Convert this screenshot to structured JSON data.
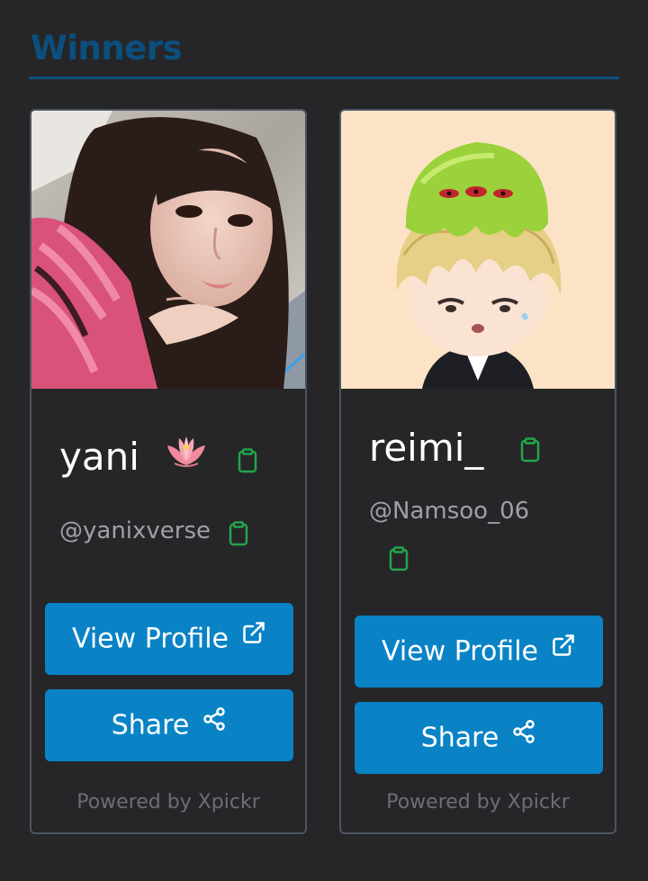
{
  "page": {
    "heading": "Winners",
    "accent_color": "#0b4f7e",
    "button_color": "#0983c6",
    "copy_icon_color": "#22a54a"
  },
  "cards": [
    {
      "display_name": "yani",
      "name_emoji": "lotus-emoji",
      "handle": "@yanixverse",
      "photo": "portrait-photo",
      "view_label": "View Profile",
      "share_label": "Share",
      "powered_by": "Powered by Xpickr"
    },
    {
      "display_name": "reimi_",
      "handle": "@Namsoo_06",
      "photo": "chibi-cartoon-avatar",
      "view_label": "View Profile",
      "share_label": "Share",
      "powered_by": "Powered by Xpickr"
    }
  ],
  "icons": {
    "copy": "clipboard-icon",
    "external": "external-link-icon",
    "share": "share-icon"
  }
}
